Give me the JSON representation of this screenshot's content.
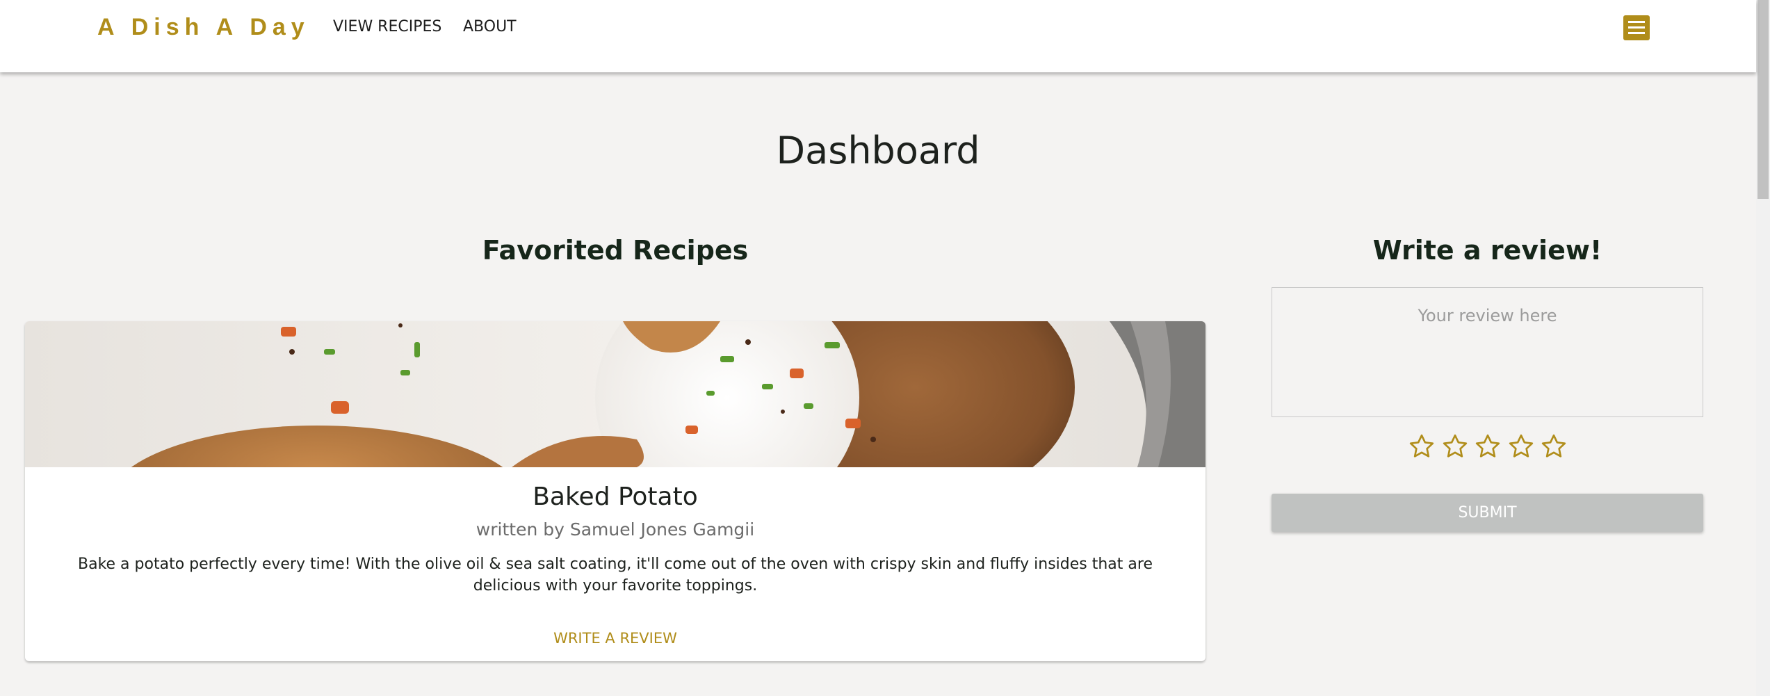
{
  "nav": {
    "brand": "A Dish A Day",
    "links": [
      "VIEW RECIPES",
      "ABOUT"
    ],
    "menu_icon": "hamburger-menu-icon"
  },
  "page": {
    "title": "Dashboard"
  },
  "favorites": {
    "heading": "Favorited Recipes",
    "recipes": [
      {
        "title": "Baked Potato",
        "author": "written by Samuel Jones Gamgii",
        "description": "Bake a potato perfectly every time! With the olive oil & sea salt coating, it'll come out of the oven with crispy skin and fluffy insides that are delicious with your favorite toppings.",
        "action": "WRITE A REVIEW"
      }
    ]
  },
  "review": {
    "heading": "Write a review!",
    "placeholder": "Your review here",
    "rating": 0,
    "max_rating": 5,
    "star_icon": "star-outline-icon",
    "submit_label": "SUBMIT"
  },
  "colors": {
    "accent": "#b08d1a",
    "background": "#f4f3f2",
    "heading": "#16261a",
    "submit_disabled": "#c0c2c1"
  }
}
